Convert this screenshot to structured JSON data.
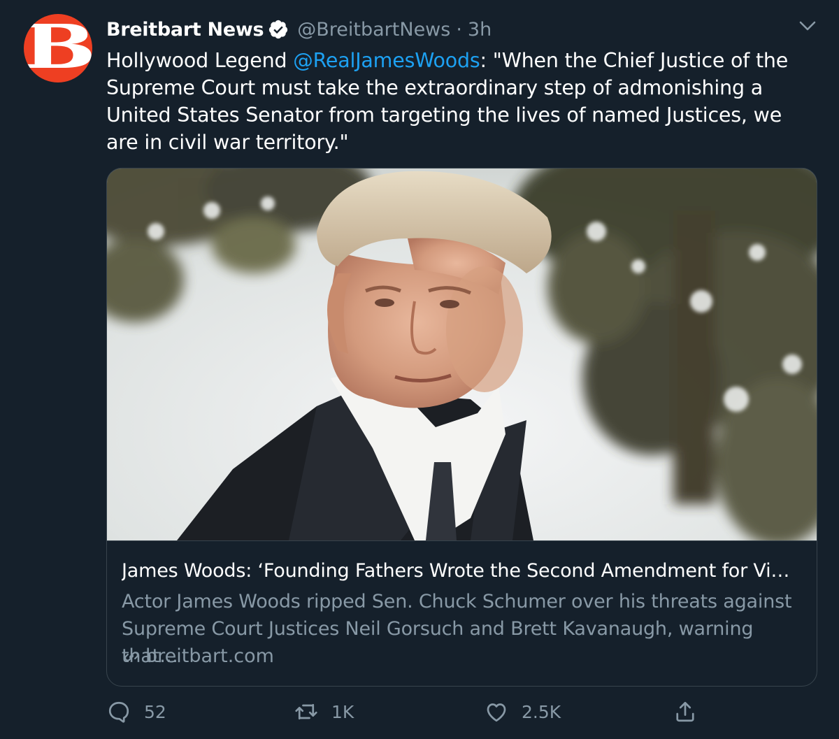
{
  "author": {
    "display_name": "Breitbart News",
    "handle": "@BreitbartNews",
    "separator": "·",
    "time": "3h",
    "avatar_letter": "B",
    "avatar_color": "#ee3f22",
    "verified": true
  },
  "tweet": {
    "text_prefix": "Hollywood Legend ",
    "mention": "@RealJamesWoods",
    "text_suffix": ": \"When the Chief Justice of the Supreme Court must take the extraordinary step of admonishing a United States Senator from targeting the lives of named Justices, we are in civil war territory.\""
  },
  "card": {
    "image_description": "portrait-photo",
    "title": "James Woods: ‘Founding Fathers Wrote the Second Amendment for Vi…",
    "description": "Actor James Woods ripped Sen. Chuck Schumer over his threats against Supreme Court Justices Neil Gorsuch and Brett Kavanaugh, warning that…",
    "domain": "breitbart.com",
    "domain_icon": "link-icon"
  },
  "actions": {
    "reply_count": "52",
    "retweet_count": "1K",
    "like_count": "2.5K",
    "reply_icon": "reply-icon",
    "retweet_icon": "retweet-icon",
    "like_icon": "heart-icon",
    "share_icon": "share-icon"
  },
  "colors": {
    "background": "#15202b",
    "text": "#ffffff",
    "muted": "#8899a6",
    "link": "#1da1f2",
    "border": "#38444d"
  }
}
